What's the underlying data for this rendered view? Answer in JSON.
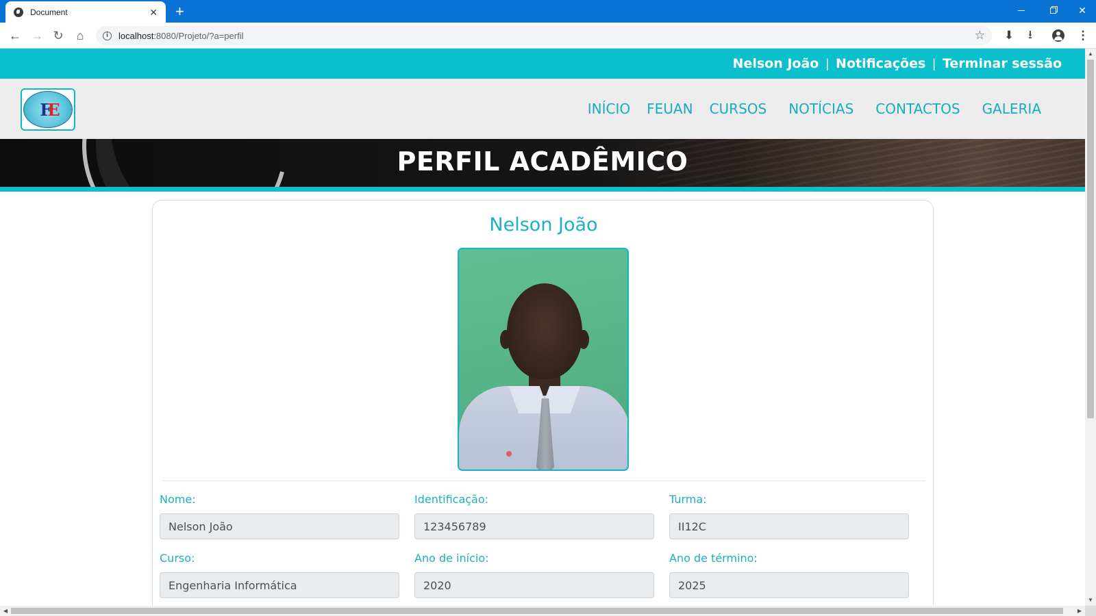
{
  "browser": {
    "tab_title": "Document",
    "tab_close": "✕",
    "new_tab": "+",
    "url_host": "localhost",
    "url_path": ":8080/Projeto/?a=perfil",
    "info_glyph": "i",
    "star_glyph": "☆",
    "back_glyph": "←",
    "forward_glyph": "→",
    "reload_glyph": "↻",
    "home_glyph": "⌂",
    "download_glyph": "⬇",
    "download2_glyph": "⭳",
    "menu_glyph": "⋮",
    "close_glyph": "✕",
    "icons": [
      "globe-icon",
      "back-icon",
      "forward-icon",
      "reload-icon",
      "home-icon",
      "info-icon",
      "star-icon",
      "download-icon",
      "profile-icon",
      "menu-icon"
    ]
  },
  "user_bar": {
    "user_name": "Nelson João",
    "notifications": "Notificações",
    "logout": "Terminar sessão",
    "separator": "|"
  },
  "nav": {
    "items": [
      "INÍCIO",
      "FEUAN",
      "CURSOS",
      "NOTÍCIAS",
      "CONTACTOS",
      "GALERIA"
    ],
    "logo_mark": "F",
    "logo_mark2": "E"
  },
  "banner": {
    "title": "PERFIL ACADÊMICO"
  },
  "profile": {
    "name": "Nelson João",
    "fields": [
      {
        "label": "Nome:",
        "value": "Nelson João"
      },
      {
        "label": "Identificação:",
        "value": "123456789"
      },
      {
        "label": "Turma:",
        "value": "II12C"
      },
      {
        "label": "Curso:",
        "value": "Engenharia Informática"
      },
      {
        "label": "Ano de início:",
        "value": "2020"
      },
      {
        "label": "Ano de término:",
        "value": "2025"
      }
    ]
  },
  "scroll": {
    "up": "▲",
    "down": "▼",
    "left": "◀",
    "right": "▶"
  },
  "colors": {
    "accent": "#0bc0cc",
    "accent_text": "#16aebf",
    "browser_blue": "#0a74d6",
    "nav_bg": "#ececec"
  }
}
